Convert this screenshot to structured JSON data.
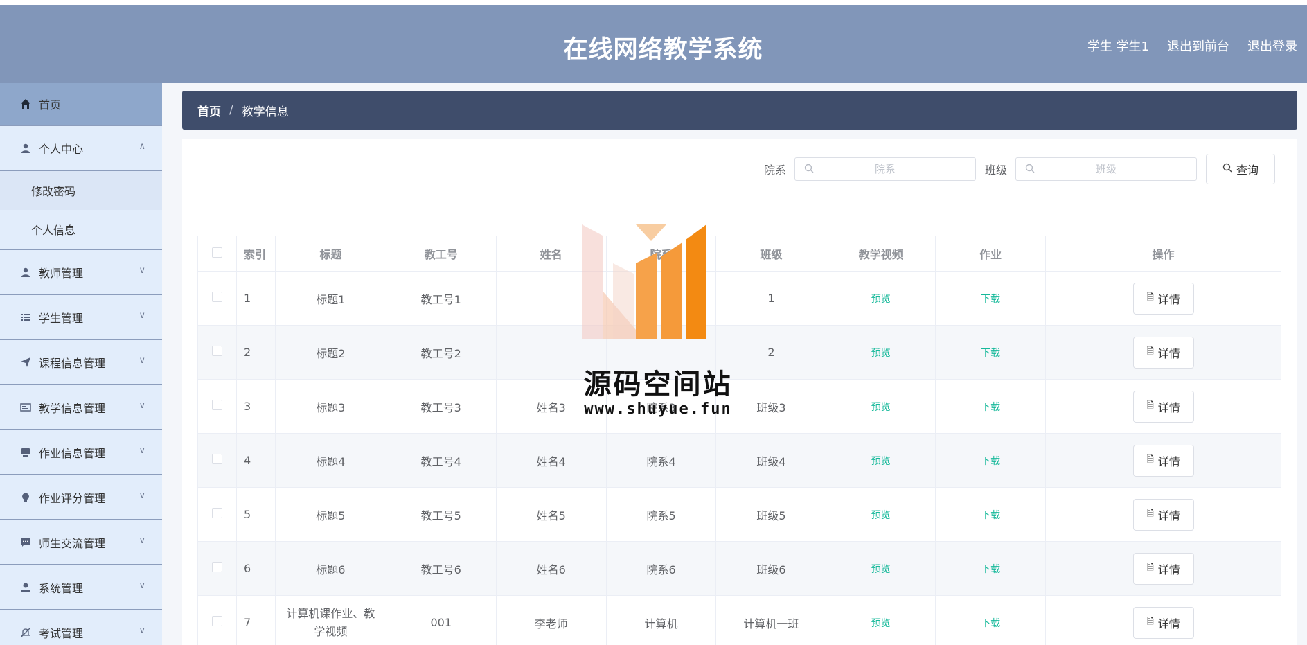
{
  "header": {
    "title": "在线网络教学系统",
    "user": "学生 学生1",
    "to_front": "退出到前台",
    "logout": "退出登录"
  },
  "sidebar": {
    "items": [
      {
        "label": "首页",
        "icon": "home-icon"
      },
      {
        "label": "个人中心",
        "icon": "user-icon",
        "children": [
          "修改密码",
          "个人信息"
        ]
      },
      {
        "label": "教师管理",
        "icon": "user-icon"
      },
      {
        "label": "学生管理",
        "icon": "list-icon"
      },
      {
        "label": "课程信息管理",
        "icon": "send-icon"
      },
      {
        "label": "教学信息管理",
        "icon": "card-icon"
      },
      {
        "label": "作业信息管理",
        "icon": "stack-icon"
      },
      {
        "label": "作业评分管理",
        "icon": "bulb-icon"
      },
      {
        "label": "师生交流管理",
        "icon": "chat-icon"
      },
      {
        "label": "系统管理",
        "icon": "admin-icon"
      },
      {
        "label": "考试管理",
        "icon": "bell-off-icon"
      }
    ]
  },
  "breadcrumb": {
    "home": "首页",
    "sep": "/",
    "current": "教学信息"
  },
  "search": {
    "dept_label": "院系",
    "dept_placeholder": "院系",
    "class_label": "班级",
    "class_placeholder": "班级",
    "query_button": "查询"
  },
  "table": {
    "headers": [
      "索引",
      "标题",
      "教工号",
      "姓名",
      "院系",
      "班级",
      "教学视频",
      "作业",
      "操作"
    ],
    "rows": [
      {
        "idx": "1",
        "title": "标题1",
        "no": "教工号1",
        "name": "",
        "dept": "",
        "cls": "1",
        "video": "预览",
        "hw": "下载",
        "op": "详情"
      },
      {
        "idx": "2",
        "title": "标题2",
        "no": "教工号2",
        "name": "",
        "dept": "",
        "cls": "2",
        "video": "预览",
        "hw": "下载",
        "op": "详情"
      },
      {
        "idx": "3",
        "title": "标题3",
        "no": "教工号3",
        "name": "姓名3",
        "dept": "院系3",
        "cls": "班级3",
        "video": "预览",
        "hw": "下载",
        "op": "详情"
      },
      {
        "idx": "4",
        "title": "标题4",
        "no": "教工号4",
        "name": "姓名4",
        "dept": "院系4",
        "cls": "班级4",
        "video": "预览",
        "hw": "下载",
        "op": "详情"
      },
      {
        "idx": "5",
        "title": "标题5",
        "no": "教工号5",
        "name": "姓名5",
        "dept": "院系5",
        "cls": "班级5",
        "video": "预览",
        "hw": "下载",
        "op": "详情"
      },
      {
        "idx": "6",
        "title": "标题6",
        "no": "教工号6",
        "name": "姓名6",
        "dept": "院系6",
        "cls": "班级6",
        "video": "预览",
        "hw": "下载",
        "op": "详情"
      },
      {
        "idx": "7",
        "title": "计算机课作业、教学视频",
        "no": "001",
        "name": "李老师",
        "dept": "计算机",
        "cls": "计算机一班",
        "video": "预览",
        "hw": "下载",
        "op": "详情"
      }
    ]
  },
  "watermark": {
    "name": "源码空间站",
    "url": "www.shuyue.fun"
  },
  "colors": {
    "header_bg": "#8196b9",
    "breadcrumb_bg": "#3f4d6b",
    "link": "#16b99a",
    "sidebar_bg": "#e2edfb"
  }
}
